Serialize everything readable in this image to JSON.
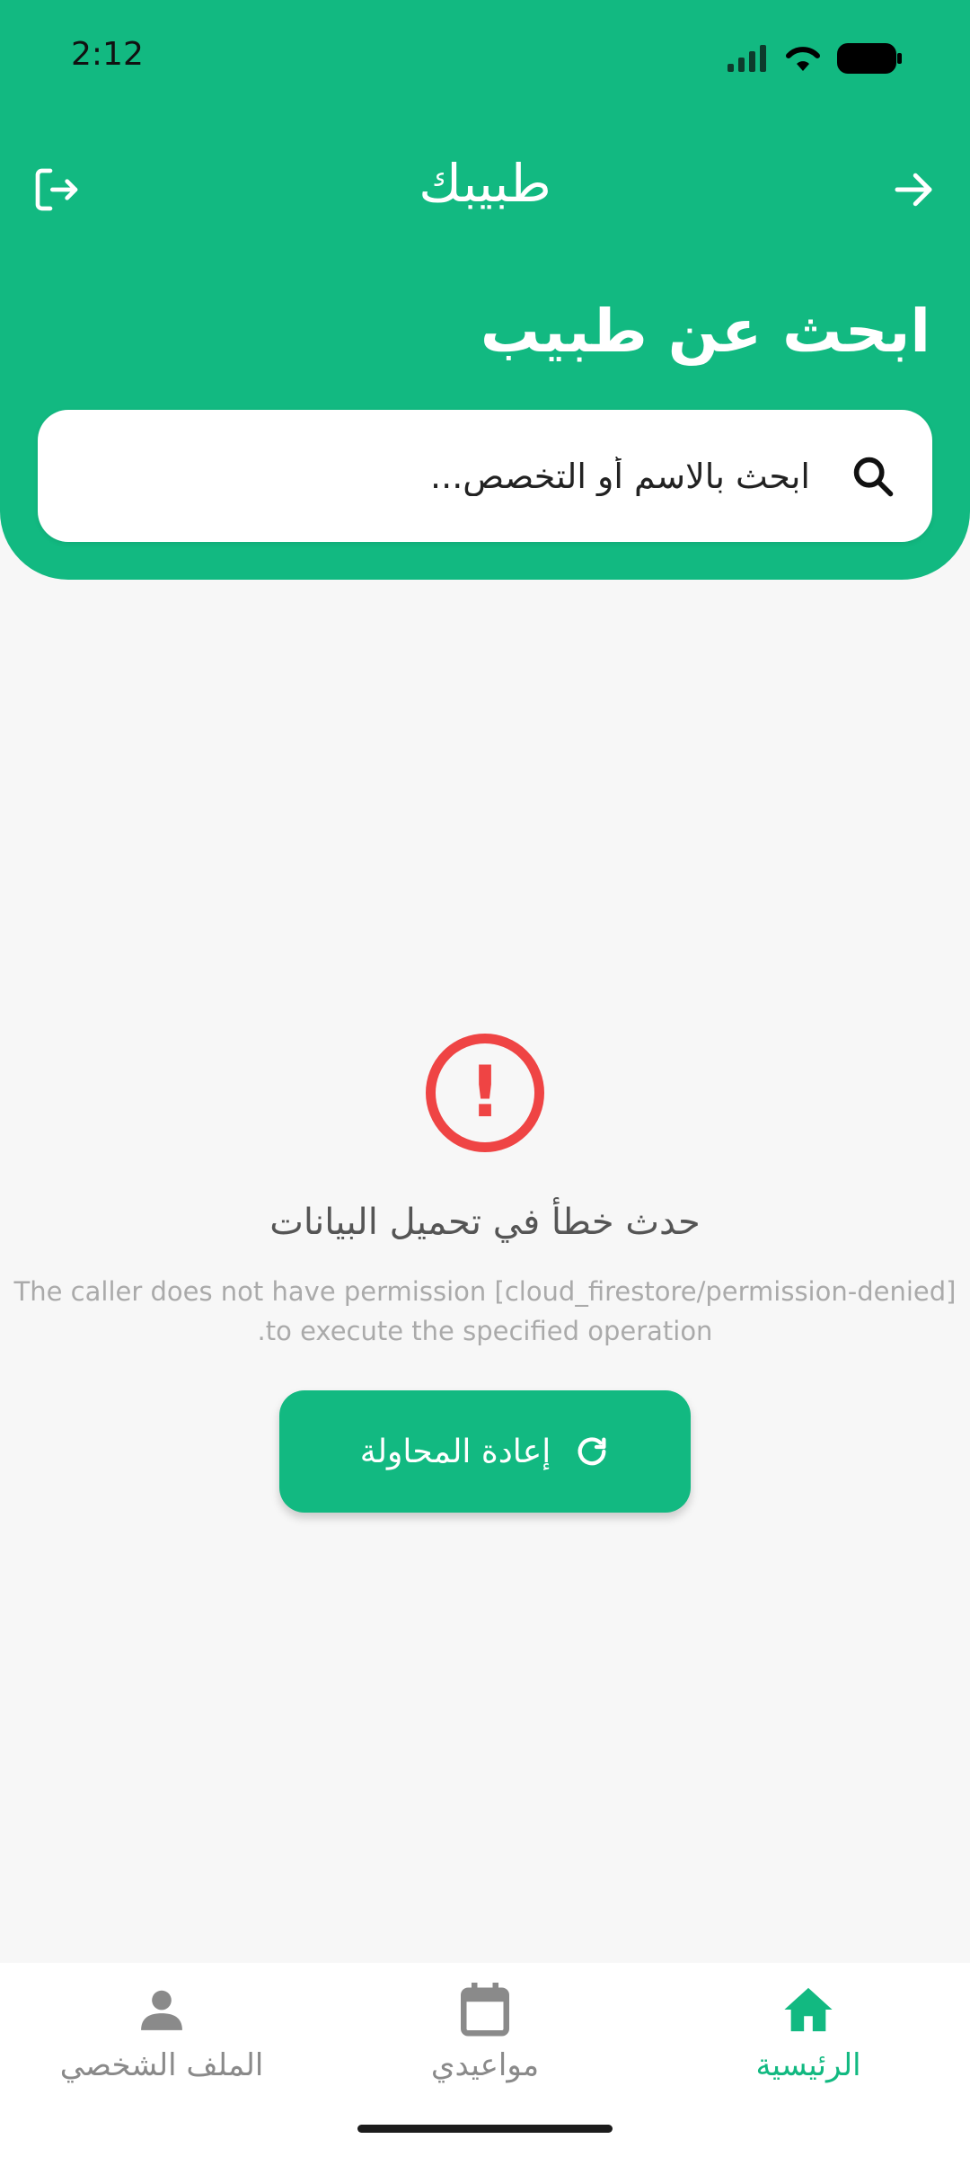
{
  "status_bar": {
    "time": "2:12"
  },
  "header": {
    "app_title": "طبيبك",
    "section_title": "ابحث عن طبيب",
    "back_icon": "arrow-right-icon",
    "logout_icon": "logout-icon"
  },
  "search": {
    "placeholder": "ابحث بالاسم أو التخصص...",
    "icon": "search-icon"
  },
  "error": {
    "icon": "error-circle-icon",
    "title": "حدث خطأ في تحميل البيانات",
    "message": "[cloud_firestore/permission-denied] The caller does not have permission to execute the specified operation.",
    "retry_label": "إعادة المحاولة"
  },
  "bottom_nav": {
    "items": [
      {
        "label": "الرئيسية",
        "icon": "home-icon",
        "active": true
      },
      {
        "label": "مواعيدي",
        "icon": "calendar-icon",
        "active": false
      },
      {
        "label": "الملف الشخصي",
        "icon": "person-icon",
        "active": false
      }
    ]
  },
  "colors": {
    "primary": "#12b981",
    "error": "#ef4444",
    "background": "#f7f7f7"
  }
}
